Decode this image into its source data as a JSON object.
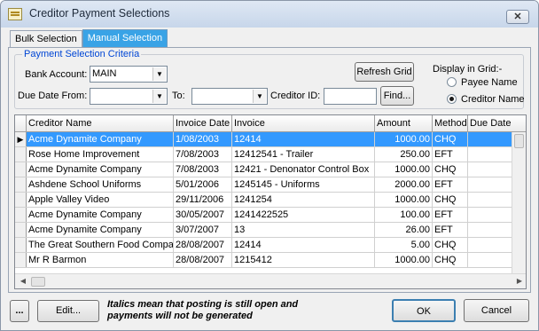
{
  "window": {
    "title": "Creditor Payment Selections",
    "close_label": "✕"
  },
  "tabs": [
    {
      "label": "Bulk Selection"
    },
    {
      "label": "Manual Selection"
    }
  ],
  "criteria": {
    "legend": "Payment Selection Criteria",
    "bank_account_label": "Bank Account:",
    "bank_account_value": "MAIN",
    "due_date_from_label": "Due Date From:",
    "due_date_from_value": "",
    "to_label": "To:",
    "to_value": "",
    "creditor_id_label": "Creditor ID:",
    "creditor_id_value": "",
    "refresh_label": "Refresh Grid",
    "find_label": "Find...",
    "display_label": "Display in Grid:-",
    "option_payee": "Payee Name",
    "option_creditor": "Creditor Name",
    "selected_option": "Creditor Name"
  },
  "grid": {
    "columns": [
      "Creditor Name",
      "Invoice Date",
      "Invoice",
      "Amount",
      "Method",
      "Due Date"
    ],
    "selected_row_marker": "▶",
    "rows": [
      {
        "creditor": "Acme Dynamite Company",
        "invoice_date": "1/08/2003",
        "invoice": "12414",
        "amount": "1000.00",
        "method": "CHQ",
        "due_date": ""
      },
      {
        "creditor": "Rose Home Improvement",
        "invoice_date": "7/08/2003",
        "invoice": "12412541 - Trailer",
        "amount": "250.00",
        "method": "EFT",
        "due_date": ""
      },
      {
        "creditor": "Acme Dynamite Company",
        "invoice_date": "7/08/2003",
        "invoice": "12421 - Denonator Control Box",
        "amount": "1000.00",
        "method": "CHQ",
        "due_date": ""
      },
      {
        "creditor": "Ashdene School Uniforms",
        "invoice_date": "5/01/2006",
        "invoice": "1245145 - Uniforms",
        "amount": "2000.00",
        "method": "EFT",
        "due_date": ""
      },
      {
        "creditor": "Apple Valley Video",
        "invoice_date": "29/11/2006",
        "invoice": "1241254",
        "amount": "1000.00",
        "method": "CHQ",
        "due_date": ""
      },
      {
        "creditor": "Acme Dynamite Company",
        "invoice_date": "30/05/2007",
        "invoice": "1241422525",
        "amount": "100.00",
        "method": "EFT",
        "due_date": ""
      },
      {
        "creditor": "Acme Dynamite Company",
        "invoice_date": "3/07/2007",
        "invoice": "13",
        "amount": "26.00",
        "method": "EFT",
        "due_date": ""
      },
      {
        "creditor": "The Great Southern Food Compan",
        "invoice_date": "28/08/2007",
        "invoice": "12414",
        "amount": "5.00",
        "method": "CHQ",
        "due_date": ""
      },
      {
        "creditor": "Mr R Barmon",
        "invoice_date": "28/08/2007",
        "invoice": "1215412",
        "amount": "1000.00",
        "method": "CHQ",
        "due_date": ""
      }
    ]
  },
  "footer": {
    "more_label": "...",
    "edit_label": "Edit...",
    "note_line1": "Italics mean that posting is still open and",
    "note_line2": "payments will not be generated",
    "ok_label": "OK",
    "cancel_label": "Cancel"
  },
  "colors": {
    "selection": "#3399ff",
    "active_tab": "#39a3e6",
    "legend_text": "#0046d5"
  }
}
